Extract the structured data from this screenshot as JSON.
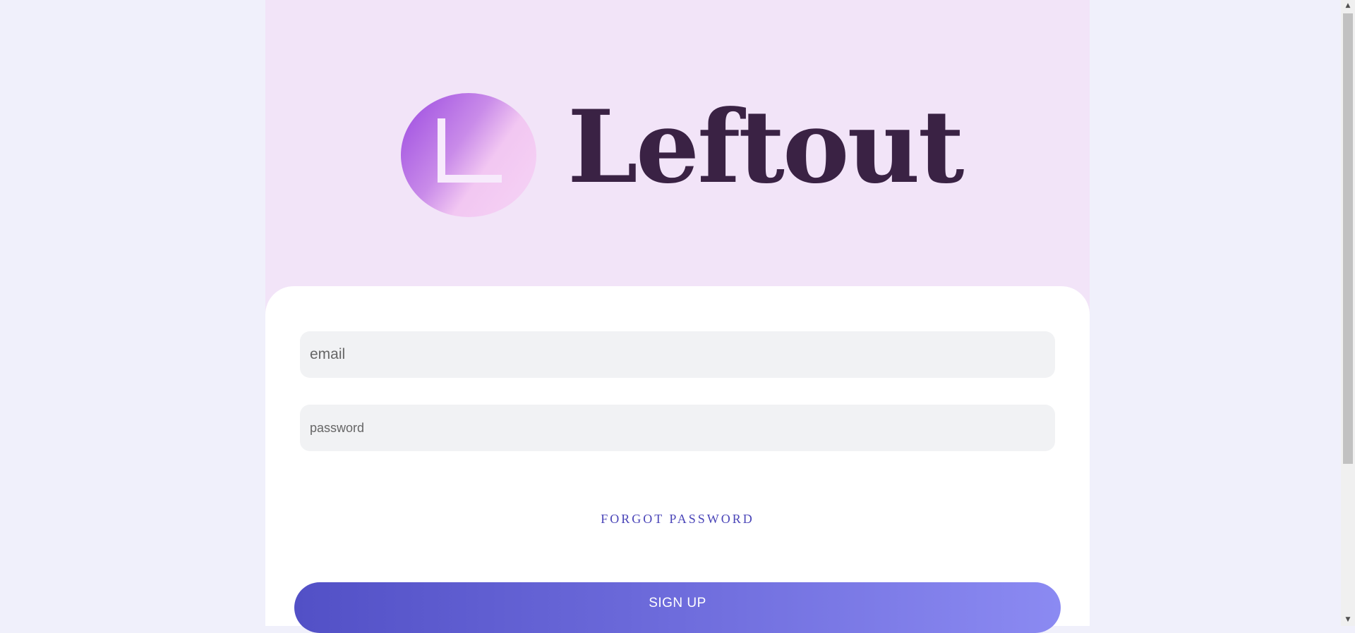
{
  "brand": {
    "logo_letter": "L",
    "name": "Leftout"
  },
  "form": {
    "email_placeholder": "email",
    "password_placeholder": "password",
    "forgot_password_label": "FORGOT PASSWORD",
    "signup_label": "SIGN UP"
  },
  "colors": {
    "page_background": "#f0f0fb",
    "hero_background": "#f2e4f8",
    "brand_text": "#3a2244",
    "link": "#4a45b8",
    "button_gradient_start": "#5250c6",
    "button_gradient_end": "#8b8af2"
  },
  "icons": {
    "scroll_up": "triangle-up-icon",
    "scroll_down": "triangle-down-icon"
  }
}
